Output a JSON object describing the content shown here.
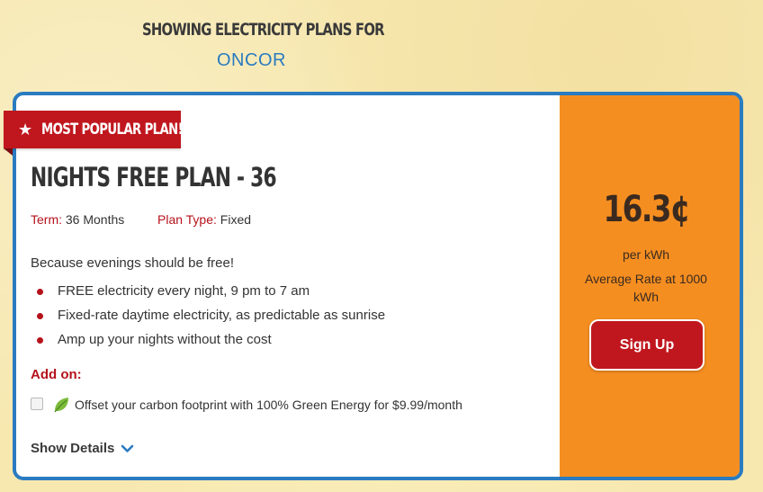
{
  "header": {
    "title": "SHOWING ELECTRICITY PLANS FOR",
    "utility": "ONCOR"
  },
  "plan": {
    "badge": "MOST POPULAR PLAN!",
    "title": "NIGHTS FREE PLAN - 36",
    "term_label": "Term:",
    "term_value": "36 Months",
    "type_label": "Plan Type:",
    "type_value": "Fixed",
    "description": "Because evenings should be free!",
    "features": [
      "FREE electricity every night, 9 pm to 7 am",
      "Fixed-rate daytime electricity, as predictable as sunrise",
      "Amp up your nights without the cost"
    ],
    "addon_label": "Add on:",
    "addon_text": "Offset your carbon footprint with 100% Green Energy for $9.99/month",
    "addon_checked": false,
    "show_details": "Show Details"
  },
  "pricing": {
    "rate": "16.3¢",
    "unit": "per kWh",
    "note": "Average Rate at 1000 kWh",
    "signup": "Sign Up"
  },
  "colors": {
    "accent_blue": "#2a7bc0",
    "brand_red": "#c0171e",
    "price_orange": "#f58e20",
    "background": "#f7e8b0"
  },
  "icons": [
    "star-icon",
    "leaf-icon",
    "chevron-down-icon"
  ]
}
